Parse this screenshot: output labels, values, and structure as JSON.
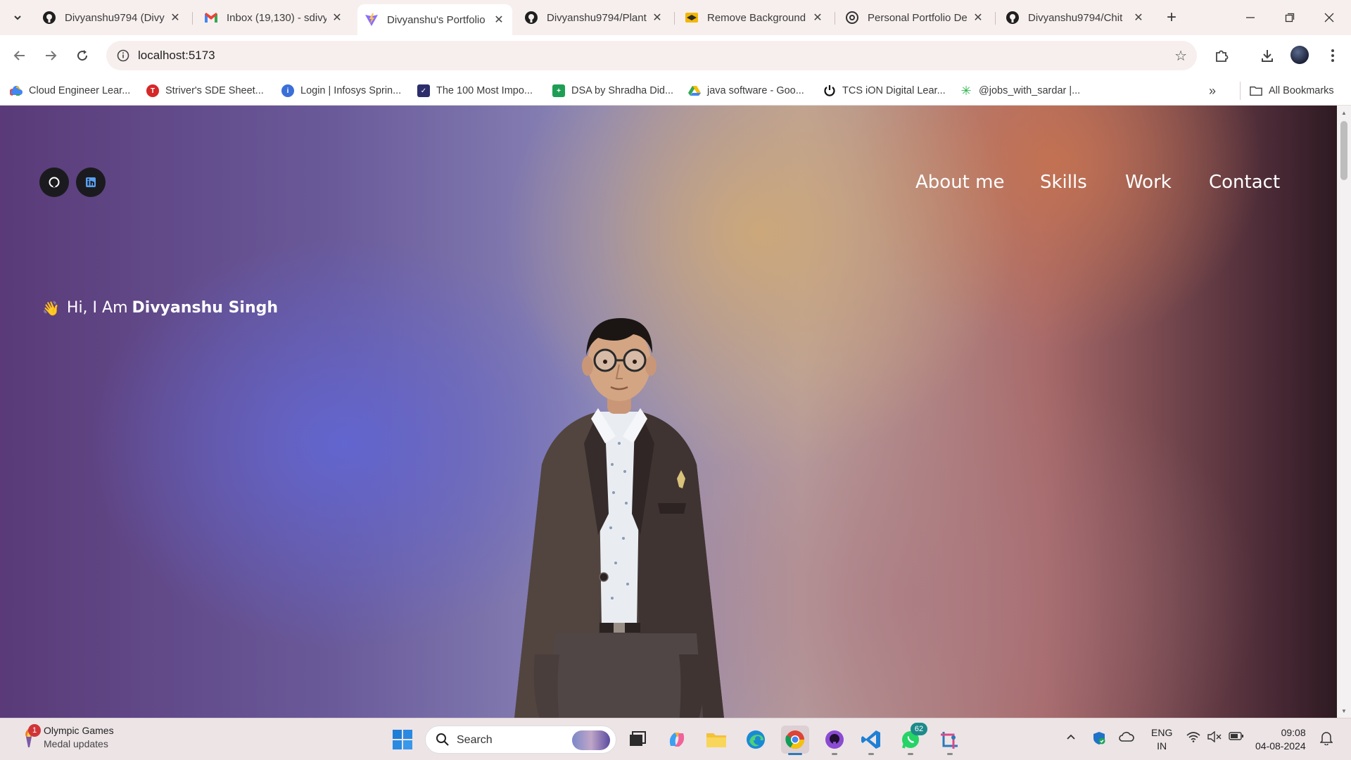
{
  "browser": {
    "tabs": [
      {
        "title": "Divyanshu9794 (Divy",
        "icon": "github-icon",
        "active": false
      },
      {
        "title": "Inbox (19,130) - sdivy",
        "icon": "gmail-icon",
        "active": false
      },
      {
        "title": "Divyanshu's Portfolio",
        "icon": "vite-icon",
        "active": true
      },
      {
        "title": "Divyanshu9794/Plant",
        "icon": "github-icon",
        "active": false
      },
      {
        "title": "Remove Background",
        "icon": "removebg-icon",
        "active": false
      },
      {
        "title": "Personal Portfolio De",
        "icon": "chatgpt-icon",
        "active": false
      },
      {
        "title": "Divyanshu9794/Chit",
        "icon": "github-icon",
        "active": false
      }
    ],
    "url": "localhost:5173",
    "bookmarks": [
      {
        "label": "Cloud Engineer Lear...",
        "icon": "google-cloud-icon"
      },
      {
        "label": "Striver's SDE Sheet...",
        "icon": "tuf-icon"
      },
      {
        "label": "Login | Infosys Sprin...",
        "icon": "infosys-icon"
      },
      {
        "label": "The 100 Most Impo...",
        "icon": "shield-bookmark-icon"
      },
      {
        "label": "DSA by Shradha Did...",
        "icon": "sheets-icon"
      },
      {
        "label": "java software - Goo...",
        "icon": "drive-icon"
      },
      {
        "label": "TCS iON Digital Lear...",
        "icon": "tcs-icon"
      },
      {
        "label": "@jobs_with_sardar |...",
        "icon": "asterisk-icon"
      }
    ],
    "all_bookmarks_label": "All Bookmarks"
  },
  "page": {
    "nav": [
      "About me",
      "Skills",
      "Work",
      "Contact"
    ],
    "greeting_prefix": "Hi, I Am",
    "greeting_name": "Divyanshu Singh",
    "wave_emoji": "👋"
  },
  "taskbar": {
    "widget_title": "Olympic Games",
    "widget_subtitle": "Medal updates",
    "widget_badge": "1",
    "search_label": "Search",
    "whatsapp_badge": "62",
    "lang_line1": "ENG",
    "lang_line2": "IN",
    "time": "09:08",
    "date": "04-08-2024"
  },
  "colors": {
    "accent_blue": "#2a7ab8",
    "page_gradient_blue": "#6266d2",
    "page_gradient_gold": "#cda878",
    "social_bg": "#1b1b1f"
  }
}
